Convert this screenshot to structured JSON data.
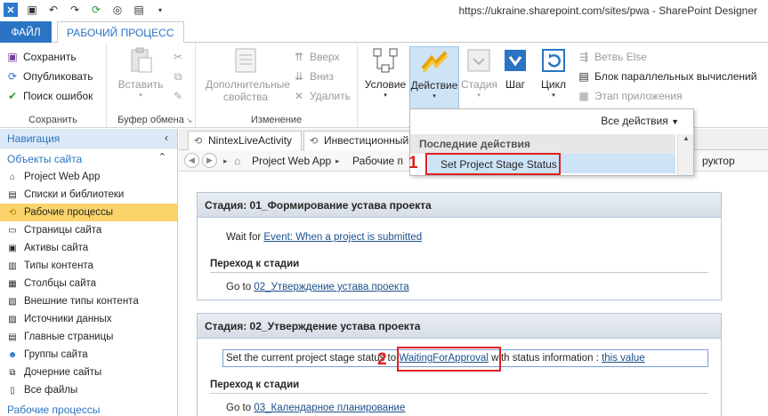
{
  "window": {
    "title": "https://ukraine.sharepoint.com/sites/pwa - SharePoint Designer",
    "qat_icons": [
      "app-icon",
      "save-icon",
      "undo-icon",
      "redo-icon",
      "refresh-icon",
      "back-icon",
      "clipboard-icon"
    ]
  },
  "ribbon": {
    "tab_file": "ФАЙЛ",
    "tab_workflow": "РАБОЧИЙ ПРОЦЕСС",
    "save_group": {
      "save": "Сохранить",
      "publish": "Опубликовать",
      "check_errors": "Поиск ошибок",
      "label": "Сохранить"
    },
    "clipboard_group": {
      "paste": "Вставить",
      "label": "Буфер обмена"
    },
    "modify_group": {
      "advanced": "Дополнительные свойства",
      "move_up": "Вверх",
      "move_down": "Вниз",
      "delete": "Удалить",
      "label": "Изменение"
    },
    "insert_group": {
      "condition": "Условие",
      "action": "Действие",
      "stage": "Стадия",
      "step": "Шаг",
      "loop": "Цикл",
      "else_branch": "Ветвь Else",
      "parallel_block": "Блок параллельных вычислений",
      "app_step": "Этап приложения"
    }
  },
  "action_dropdown": {
    "all_actions": "Все действия",
    "recent_header": "Последние действия",
    "recent_item": "Set Project Stage Status"
  },
  "navigation": {
    "header": "Навигация",
    "section": "Объекты сайта",
    "items": [
      {
        "label": "Project Web App",
        "icon": "site-icon"
      },
      {
        "label": "Списки и библиотеки",
        "icon": "lists-icon"
      },
      {
        "label": "Рабочие процессы",
        "icon": "workflow-icon"
      },
      {
        "label": "Страницы сайта",
        "icon": "pages-icon"
      },
      {
        "label": "Активы сайта",
        "icon": "assets-icon"
      },
      {
        "label": "Типы контента",
        "icon": "content-types-icon"
      },
      {
        "label": "Столбцы сайта",
        "icon": "columns-icon"
      },
      {
        "label": "Внешние типы контента",
        "icon": "external-types-icon"
      },
      {
        "label": "Источники данных",
        "icon": "datasources-icon"
      },
      {
        "label": "Главные страницы",
        "icon": "master-pages-icon"
      },
      {
        "label": "Группы сайта",
        "icon": "groups-icon"
      },
      {
        "label": "Дочерние сайты",
        "icon": "subsites-icon"
      },
      {
        "label": "Все файлы",
        "icon": "all-files-icon"
      }
    ],
    "bottom_section": "Рабочие процессы"
  },
  "editor": {
    "tabs": [
      "NintexLiveActivity",
      "Инвестиционный п"
    ],
    "breadcrumb": [
      "Project Web App",
      "Рабочие п",
      "руктор"
    ]
  },
  "stages": [
    {
      "title": "Стадия: 01_Формирование устава проекта",
      "action_prefix": "Wait for ",
      "action_link": "Event: When a project is submitted",
      "transition_header": "Переход к стадии",
      "goto_prefix": "Go to ",
      "goto_link": "02_Утверждение устава проекта"
    },
    {
      "title": "Стадия: 02_Утверждение устава проекта",
      "action_prefix": "Set the current project stage status to ",
      "action_link": "WaitingForApproval",
      "action_middle": " with status information : ",
      "action_link2": "this value",
      "transition_header": "Переход к стадии",
      "goto_prefix": "Go to ",
      "goto_link": "03_Календарное планирование"
    }
  ],
  "annotations": {
    "marker1": "1",
    "marker2": "2",
    "color": "#e02020"
  }
}
